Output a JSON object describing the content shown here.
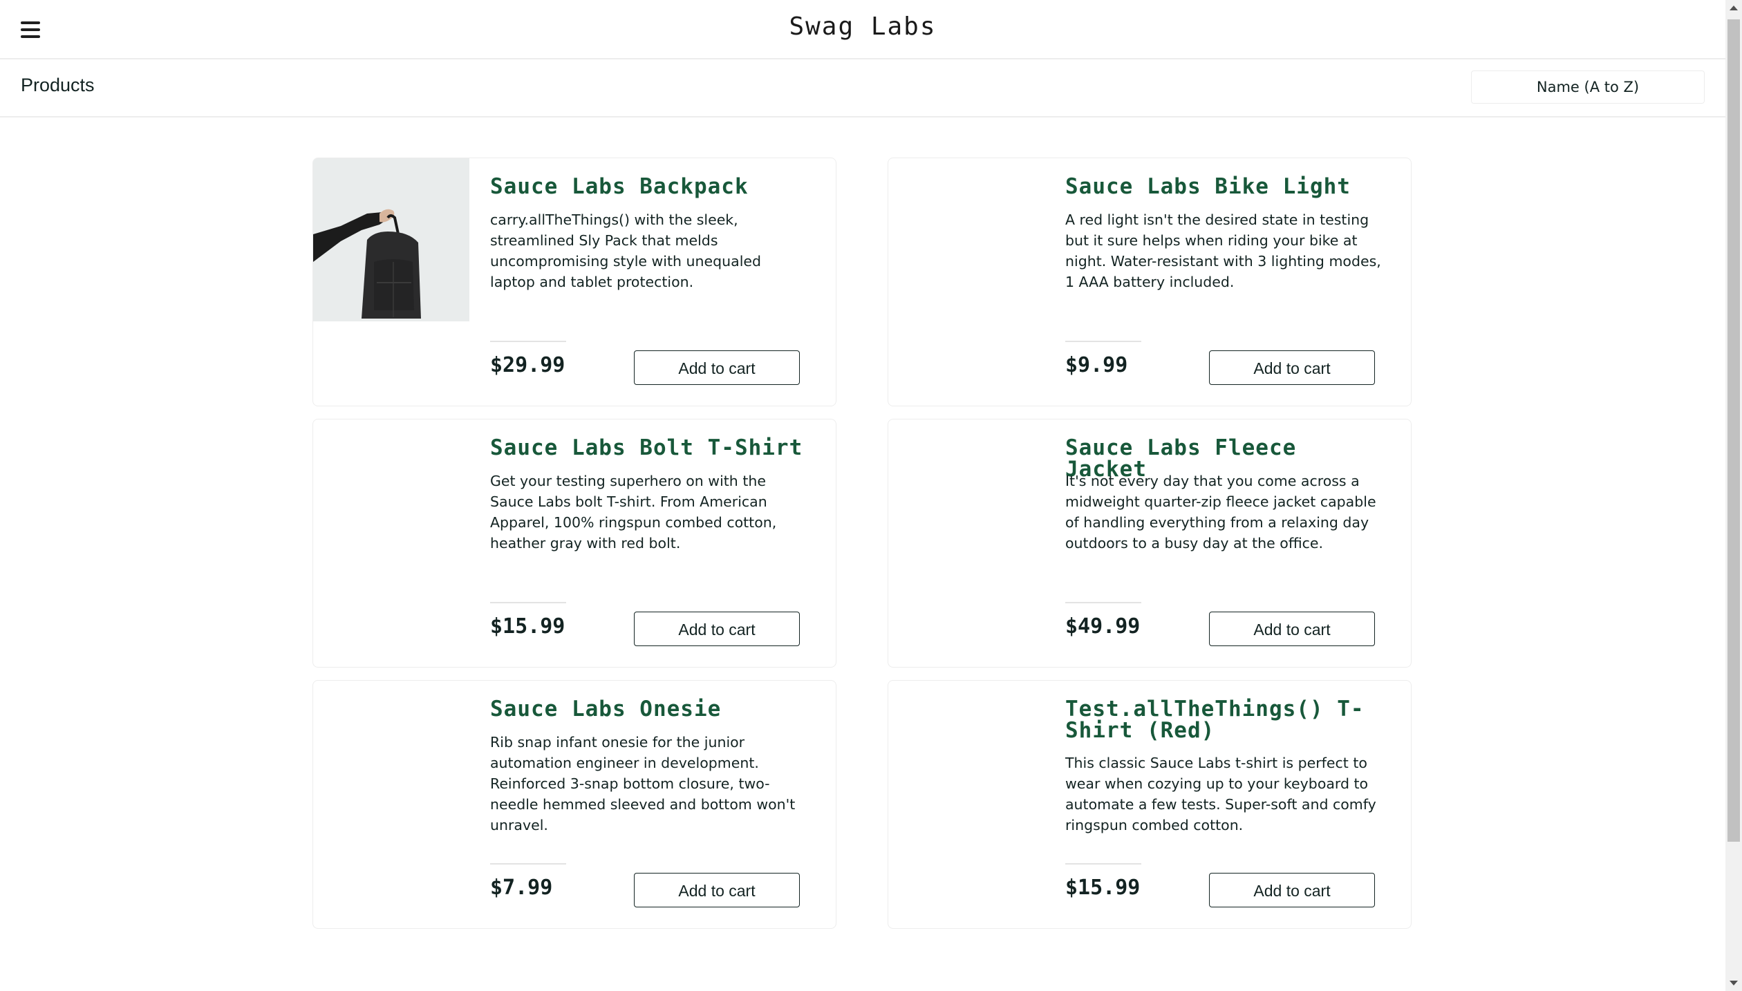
{
  "header": {
    "app_logo": "Swag Labs",
    "menu_icon": "hamburger-menu-icon"
  },
  "secondary": {
    "title": "Products",
    "sort_selected": "Name (A to Z)"
  },
  "items": [
    {
      "name": "Sauce Labs Backpack",
      "description": "carry.allTheThings() with the sleek, streamlined Sly Pack that melds uncompromising style with unequaled laptop and tablet protection.",
      "price": "$29.99",
      "button": "Add to cart",
      "has_image": true
    },
    {
      "name": "Sauce Labs Bike Light",
      "description": "A red light isn't the desired state in testing but it sure helps when riding your bike at night. Water-resistant with 3 lighting modes, 1 AAA battery included.",
      "price": "$9.99",
      "button": "Add to cart",
      "has_image": false
    },
    {
      "name": "Sauce Labs Bolt T-Shirt",
      "description": "Get your testing superhero on with the Sauce Labs bolt T-shirt. From American Apparel, 100% ringspun combed cotton, heather gray with red bolt.",
      "price": "$15.99",
      "button": "Add to cart",
      "has_image": false
    },
    {
      "name": "Sauce Labs Fleece Jacket",
      "description": "It's not every day that you come across a midweight quarter-zip fleece jacket capable of handling everything from a relaxing day outdoors to a busy day at the office.",
      "price": "$49.99",
      "button": "Add to cart",
      "has_image": false
    },
    {
      "name": "Sauce Labs Onesie",
      "description": "Rib snap infant onesie for the junior automation engineer in development. Reinforced 3-snap bottom closure, two-needle hemmed sleeved and bottom won't unravel.",
      "price": "$7.99",
      "button": "Add to cart",
      "has_image": false
    },
    {
      "name": "Test.allTheThings() T-Shirt (Red)",
      "description": "This classic Sauce Labs t-shirt is perfect to wear when cozying up to your keyboard to automate a few tests. Super-soft and comfy ringspun combed cotton.",
      "price": "$15.99",
      "button": "Add to cart",
      "has_image": false
    }
  ],
  "colors": {
    "item_name": "#18583a",
    "text": "#132322",
    "border": "#ededed"
  }
}
